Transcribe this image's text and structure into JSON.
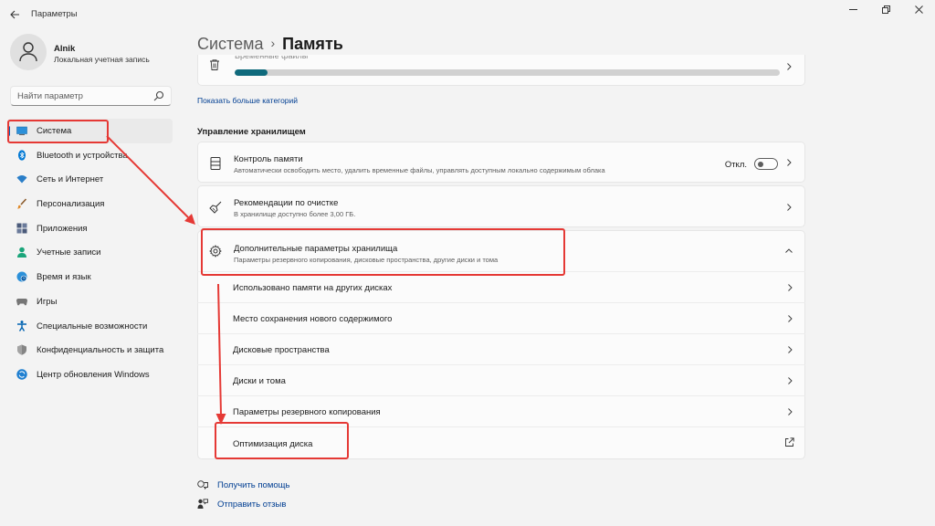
{
  "window": {
    "title": "Параметры",
    "back_icon": "back-arrow-icon",
    "controls": [
      "minimize-icon",
      "restore-icon",
      "close-icon"
    ]
  },
  "profile": {
    "name": "Alnik",
    "account_type": "Локальная учетная запись"
  },
  "search": {
    "placeholder": "Найти параметр"
  },
  "sidebar": {
    "items": [
      {
        "label": "Система",
        "icon": "monitor-icon",
        "color": "#0078d4",
        "active": true
      },
      {
        "label": "Bluetooth и устройства",
        "icon": "bluetooth-icon",
        "color": "#0078d4"
      },
      {
        "label": "Сеть и Интернет",
        "icon": "wifi-icon",
        "color": "#0063b1"
      },
      {
        "label": "Персонализация",
        "icon": "brush-icon",
        "color": "#d4802a"
      },
      {
        "label": "Приложения",
        "icon": "apps-icon",
        "color": "#4a5a7a"
      },
      {
        "label": "Учетные записи",
        "icon": "person-icon",
        "color": "#1aa57a"
      },
      {
        "label": "Время и язык",
        "icon": "globe-clock-icon",
        "color": "#0078d4"
      },
      {
        "label": "Игры",
        "icon": "gamepad-icon",
        "color": "#767676"
      },
      {
        "label": "Специальные возможности",
        "icon": "accessibility-icon",
        "color": "#0063b1"
      },
      {
        "label": "Конфиденциальность и защита",
        "icon": "shield-icon",
        "color": "#767676"
      },
      {
        "label": "Центр обновления Windows",
        "icon": "update-icon",
        "color": "#0078d4"
      }
    ]
  },
  "breadcrumb": {
    "parent": "Система",
    "separator": "›",
    "current": "Память"
  },
  "storage_top": {
    "cut_label": "Временные файлы",
    "usage_fraction": 0.06
  },
  "show_more_label": "Показать больше категорий",
  "section_title": "Управление хранилищем",
  "storage_sense": {
    "title": "Контроль памяти",
    "subtitle": "Автоматически освободить место, удалить временные файлы, управлять доступным локально содержимым облака",
    "toggle_label": "Откл.",
    "toggle_on": false
  },
  "cleanup": {
    "title": "Рекомендации по очистке",
    "subtitle": "В хранилище доступно более 3,00 ГБ."
  },
  "advanced": {
    "title": "Дополнительные параметры хранилища",
    "subtitle": "Параметры резервного копирования, дисковые пространства, другие диски и тома",
    "expanded": true,
    "items": [
      {
        "label": "Использовано памяти на других дисках"
      },
      {
        "label": "Место сохранения нового содержимого"
      },
      {
        "label": "Дисковые пространства"
      },
      {
        "label": "Диски и тома"
      },
      {
        "label": "Параметры резервного копирования"
      },
      {
        "label": "Оптимизация диска",
        "external": true
      }
    ]
  },
  "footer": {
    "help": "Получить помощь",
    "feedback": "Отправить отзыв"
  },
  "annotation_color": "#e53935"
}
